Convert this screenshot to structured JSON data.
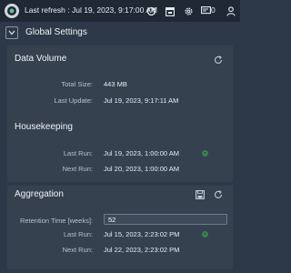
{
  "topbar": {
    "refresh_label": "Last refresh : Jul 19, 2023, 9:17:00 AM",
    "notification_count": "0",
    "icons": [
      "app-logo-icon",
      "wand-icon",
      "calendar-icon",
      "gear-icon",
      "notification-icon",
      "user-icon"
    ]
  },
  "global_settings": {
    "title": "Global Settings"
  },
  "data_volume": {
    "title": "Data Volume",
    "total_size_label": "Total Size:",
    "total_size_value": "443 MB",
    "last_update_label": "Last Update:",
    "last_update_value": "Jul 19, 2023, 9:17:11 AM"
  },
  "housekeeping": {
    "title": "Housekeeping",
    "last_run_label": "Last Run:",
    "last_run_value": "Jul 19, 2023, 1:00:00 AM",
    "next_run_label": "Next Run:",
    "next_run_value": "Jul 20, 2023, 1:00:00 AM"
  },
  "aggregation": {
    "title": "Aggregation",
    "retention_label": "Retention Time [weeks]:",
    "retention_value": "52",
    "last_run_label": "Last Run:",
    "last_run_value": "Jul 15, 2023, 2:23:02 PM",
    "next_run_label": "Next Run:",
    "next_run_value": "Jul 22, 2023, 2:23:02 PM"
  },
  "colors": {
    "background": "#2d3948",
    "topbar": "#1f2833",
    "status_ok": "#3fa34d"
  }
}
